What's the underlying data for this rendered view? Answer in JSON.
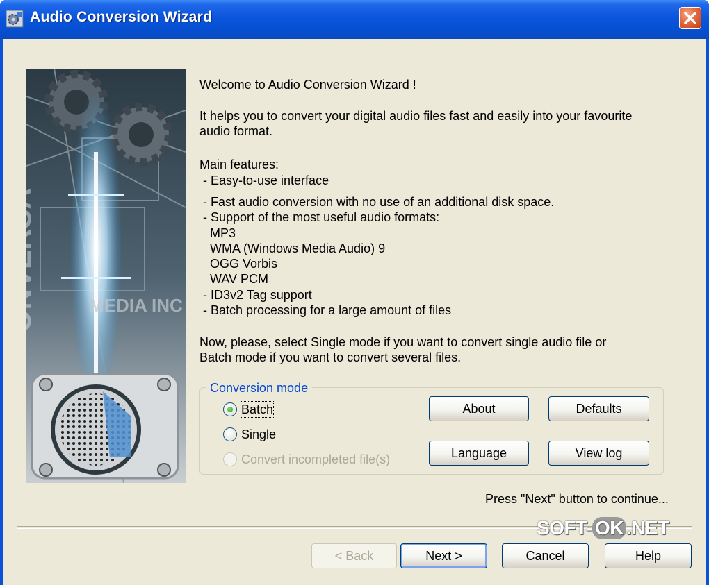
{
  "window": {
    "title": "Audio Conversion Wizard"
  },
  "content": {
    "welcome": "Welcome to Audio Conversion Wizard !",
    "intro_line1": "It helps you to convert your digital audio files fast and easily into your favourite",
    "intro_line2": "audio format.",
    "features_heading": "Main features:",
    "feature_easy": " - Easy-to-use interface",
    "feature_fast": " - Fast audio conversion with no use of an additional disk space.",
    "feature_formats": " - Support of the most useful audio formats:",
    "format_mp3": "MP3",
    "format_wma": "WMA (Windows Media Audio) 9",
    "format_ogg": "OGG Vorbis",
    "format_wav": "WAV PCM",
    "feature_id3": " - ID3v2 Tag support",
    "feature_batch": " - Batch processing for a large amount of files",
    "instruction_line1": "Now, please, select Single mode if you want to convert single audio file or",
    "instruction_line2": "Batch mode if you want to convert several files.",
    "continue_hint": "Press \"Next\" button to continue..."
  },
  "conversion_mode": {
    "title": "Conversion mode",
    "options": [
      {
        "label": "Batch",
        "checked": true,
        "enabled": true
      },
      {
        "label": "Single",
        "checked": false,
        "enabled": true
      },
      {
        "label": "Convert incompleted file(s)",
        "checked": false,
        "enabled": false
      }
    ],
    "buttons": {
      "about": "About",
      "defaults": "Defaults",
      "language": "Language",
      "view_log": "View log"
    }
  },
  "footer": {
    "back": "< Back",
    "next": "Next >",
    "cancel": "Cancel",
    "help": "Help"
  },
  "watermark": {
    "part1": "SOFT-",
    "part2": "OK",
    "part3": ".NET"
  },
  "side_art": {
    "caption": "MEDIA INC"
  },
  "colors": {
    "titlebar": "#0a55dc",
    "dialog_bg": "#ece9d8",
    "group_title": "#0046d5",
    "close_button": "#e46a3f"
  }
}
